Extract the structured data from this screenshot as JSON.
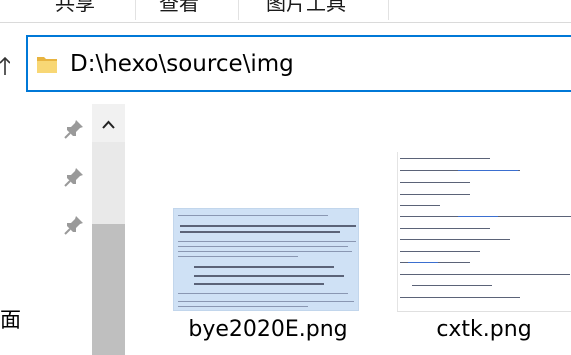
{
  "ribbon": {
    "tabs": [
      "共享",
      "查看",
      "图片工具"
    ]
  },
  "address_bar": {
    "path": "D:\\hexo\\source\\img"
  },
  "nav_pane": {
    "partial_item": "面"
  },
  "files": [
    {
      "name": "bye2020E.png"
    },
    {
      "name": "cxtk.png"
    }
  ],
  "colors": {
    "accent": "#0078d7",
    "thumb_bg": "#cfe1f5"
  },
  "icons": [
    "folder-icon",
    "pin-icon",
    "chevron-up-icon"
  ]
}
